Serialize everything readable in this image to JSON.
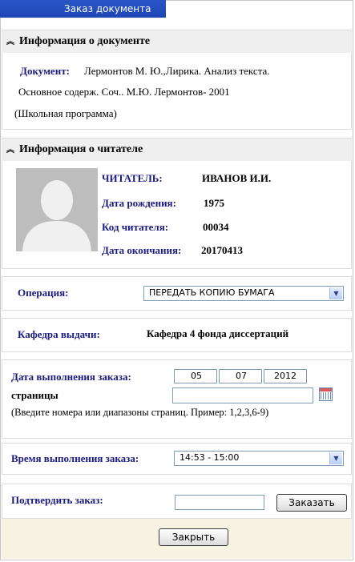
{
  "window": {
    "title": "Заказ документа"
  },
  "doc_section": {
    "heading": "Информация о документе",
    "doc_label": "Документ:",
    "doc_line1": "Лермонтов М. Ю.,Лирика. Анализ текста.",
    "doc_line2": "Основное содерж. Соч.. М.Ю. Лермонтов-  2001",
    "doc_line3": "(Школьная программа)"
  },
  "reader_section": {
    "heading": "Информация о читателе",
    "rows": [
      {
        "label": "ЧИТАТЕЛЬ:",
        "value": "ИВАНОВ И.И."
      },
      {
        "label": "Дата рождения:",
        "value": "1975"
      },
      {
        "label": "Код читателя:",
        "value": "00034"
      },
      {
        "label": "Дата окончания:",
        "value": "20170413"
      }
    ]
  },
  "operation": {
    "label": "Операция:",
    "selected": "ПЕРЕДАТЬ КОПИЮ БУМАГА"
  },
  "department": {
    "label": "Кафедра выдачи:",
    "value": "Кафедра 4 фонда диссертаций"
  },
  "order_date": {
    "label": "Дата выполнения заказа:",
    "day": "05",
    "month": "07",
    "year": "2012",
    "pages_label": "страницы",
    "pages_value": "",
    "hint": "(Введите номера или диапазоны страниц. Пример: 1,2,3,6-9)"
  },
  "order_time": {
    "label": "Время выполнения заказа:",
    "selected": "14:53 - 15:00"
  },
  "confirm": {
    "label": "Подтвердить заказ:",
    "value": "",
    "button": "Заказать"
  },
  "close_button": "Закрыть"
}
